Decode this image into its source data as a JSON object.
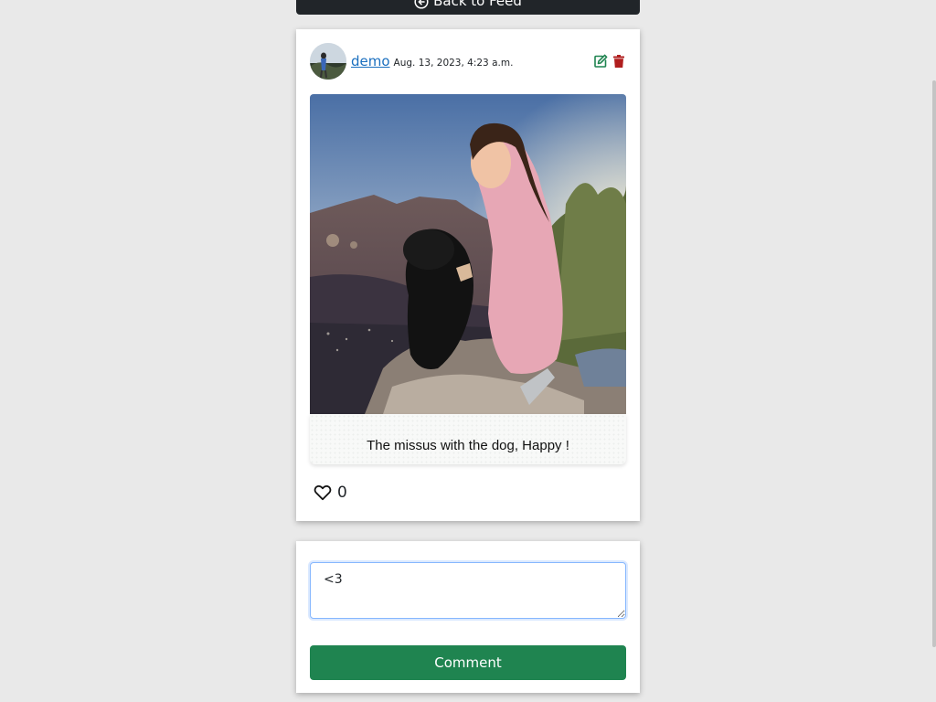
{
  "nav": {
    "back_label": "Back to Feed",
    "back_icon": "arrow-left-circle-icon"
  },
  "post": {
    "author": "demo",
    "date": "Aug. 13, 2023, 4:23 a.m.",
    "caption": "The missus with the dog, Happy !",
    "like_count": "0",
    "edit_icon": "edit-icon",
    "delete_icon": "trash-icon",
    "like_icon": "heart-outline-icon"
  },
  "comment": {
    "input_value": "<3",
    "submit_label": "Comment"
  },
  "colors": {
    "nav_bg": "#212529",
    "link": "#1a6fbf",
    "edit": "#1f8450",
    "delete": "#b01e1e",
    "button": "#1f8450",
    "page_bg": "#e9e9e9"
  }
}
